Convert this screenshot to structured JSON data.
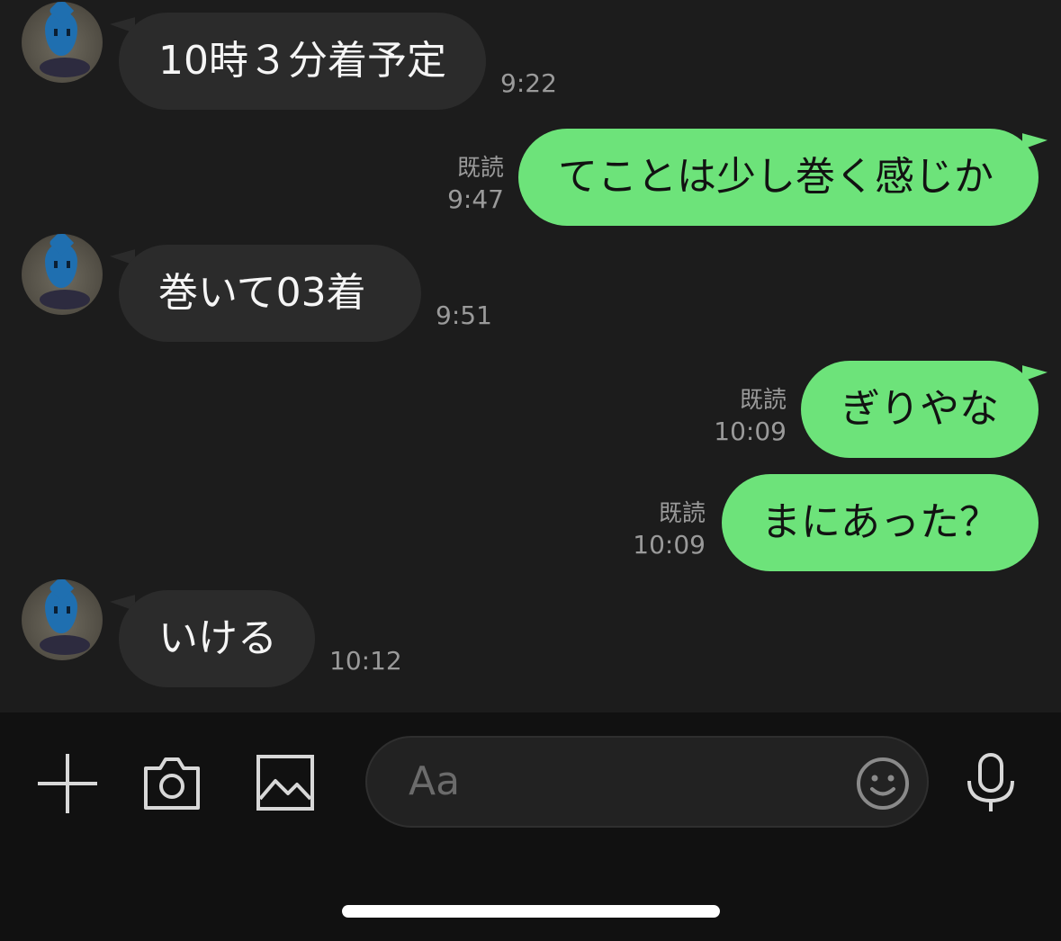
{
  "messages": [
    {
      "text": "10時３分着予定",
      "time": "9:22"
    },
    {
      "text": "てことは少し巻く感じか",
      "read": "既読",
      "time": "9:47"
    },
    {
      "text": "巻いて03着",
      "time": "9:51"
    },
    {
      "text": "ぎりやな",
      "read": "既読",
      "time": "10:09"
    },
    {
      "text": "まにあった？",
      "read": "既読",
      "time": "10:09"
    },
    {
      "text": "いける",
      "time": "10:12"
    }
  ],
  "composer": {
    "placeholder": "Aa"
  },
  "icons": {
    "add": "plus-icon",
    "camera": "camera-icon",
    "image": "image-icon",
    "emoji": "smiley-icon",
    "mic": "microphone-icon"
  },
  "colors": {
    "background": "#1c1c1c",
    "incoming_bubble": "#2b2b2b",
    "outgoing_bubble": "#6de37a",
    "toolbar": "#111111"
  }
}
